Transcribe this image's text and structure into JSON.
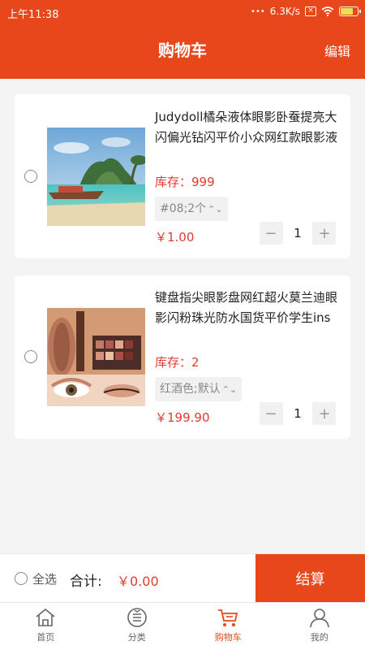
{
  "status_bar": {
    "time": "上午11:38",
    "speed": "6.3K/s"
  },
  "header": {
    "title": "购物车",
    "edit_label": "编辑"
  },
  "cart_items": [
    {
      "name": "Judydoll橘朵液体眼影卧蚕提亮大闪偏光钻闪平价小众网红款眼影液",
      "stock": "库存：999",
      "spec": "#08;2个",
      "price": "￥1.00",
      "quantity": "1"
    },
    {
      "name": "键盘指尖眼影盘网红超火莫兰迪眼影闪粉珠光防水国货平价学生ins",
      "stock": "库存：2",
      "spec": "红酒色;默认",
      "price": "￥199.90",
      "quantity": "1"
    }
  ],
  "checkout": {
    "select_all_label": "全选",
    "total_label": "合计:",
    "total_value": "￥0.00",
    "settle_label": "结算"
  },
  "tabs": [
    {
      "label": "首页",
      "icon": "home-icon"
    },
    {
      "label": "分类",
      "icon": "category-icon"
    },
    {
      "label": "购物车",
      "icon": "cart-icon"
    },
    {
      "label": "我的",
      "icon": "profile-icon"
    }
  ],
  "colors": {
    "brand": "#e8471c",
    "price": "#e03b2e"
  }
}
